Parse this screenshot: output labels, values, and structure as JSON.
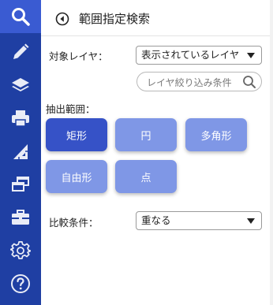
{
  "sidebar": {
    "items": [
      {
        "icon": "search-icon",
        "active": true
      },
      {
        "icon": "pencil-icon"
      },
      {
        "icon": "layers-icon"
      },
      {
        "icon": "printer-icon"
      },
      {
        "icon": "measure-icon"
      },
      {
        "icon": "windows-icon"
      },
      {
        "icon": "toolbox-icon"
      },
      {
        "icon": "gear-icon"
      },
      {
        "icon": "help-icon"
      }
    ]
  },
  "header": {
    "title": "範囲指定検索",
    "back_icon": "back-arrow-icon"
  },
  "target_layer": {
    "label": "対象レイヤ：",
    "selected": "表示されているレイヤ"
  },
  "layer_filter": {
    "placeholder": "レイヤ絞り込み条件"
  },
  "extract_range": {
    "label": "抽出範囲：",
    "buttons": [
      {
        "label": "矩形",
        "selected": true
      },
      {
        "label": "円"
      },
      {
        "label": "多角形"
      },
      {
        "label": "自由形"
      },
      {
        "label": "点"
      }
    ]
  },
  "compare": {
    "label": "比較条件：",
    "selected": "重なる"
  },
  "colors": {
    "sidebar": "#1f3fa3",
    "sidebar_active": "#3a5bd2",
    "button": "#7f97e6",
    "button_selected": "#3652c7"
  }
}
